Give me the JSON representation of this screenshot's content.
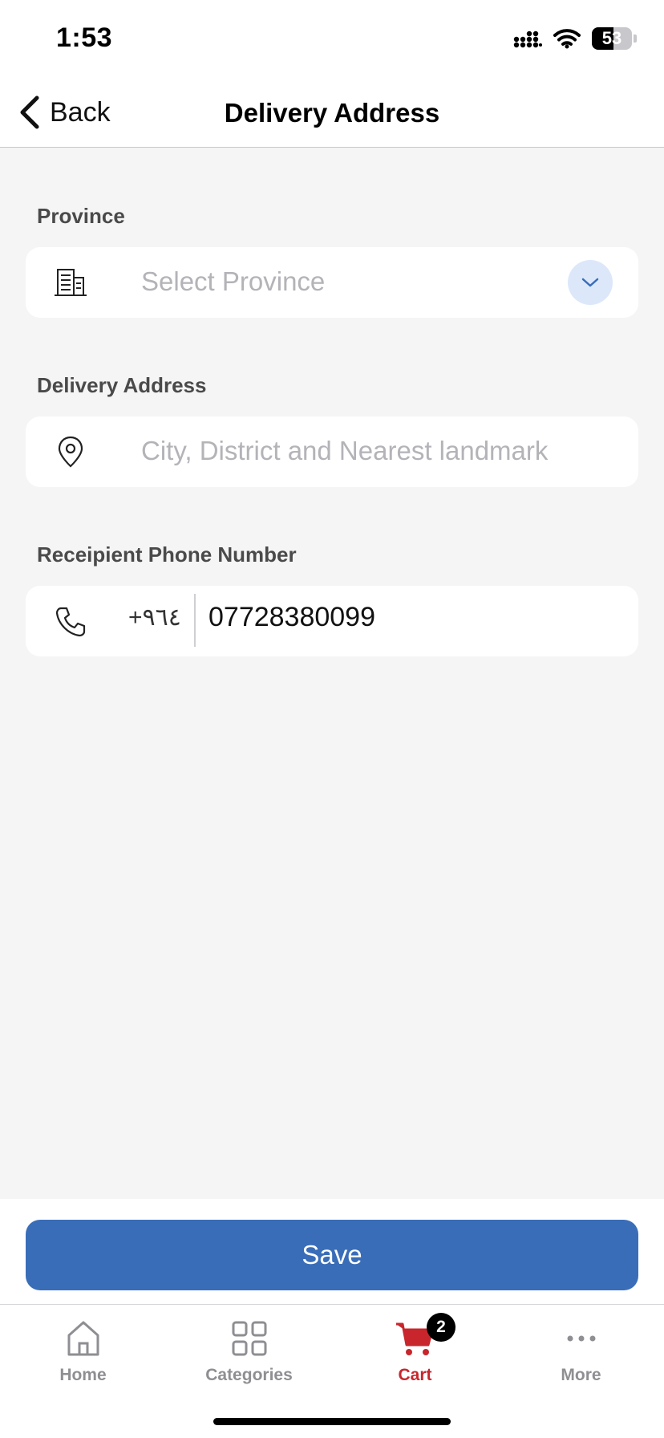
{
  "status_bar": {
    "time": "1:53",
    "battery": "53",
    "battery_level_percent": 53
  },
  "nav": {
    "back_label": "Back",
    "title": "Delivery Address"
  },
  "form": {
    "province": {
      "label": "Province",
      "placeholder": "Select Province",
      "icon": "building-icon"
    },
    "address": {
      "label": "Delivery Address",
      "placeholder": "City, District and Nearest landmark",
      "icon": "map-pin-icon"
    },
    "phone": {
      "label": "Receipient Phone Number",
      "country_code": "+٩٦٤",
      "value": "07728380099",
      "icon": "phone-icon"
    }
  },
  "save_label": "Save",
  "tabs": [
    {
      "label": "Home",
      "icon": "home-icon",
      "active": false
    },
    {
      "label": "Categories",
      "icon": "grid-icon",
      "active": false
    },
    {
      "label": "Cart",
      "icon": "cart-icon",
      "active": true,
      "badge": "2"
    },
    {
      "label": "More",
      "icon": "more-icon",
      "active": false
    }
  ],
  "colors": {
    "accent": "#396db8",
    "active_tab": "#c8262c",
    "background": "#f5f5f5"
  }
}
